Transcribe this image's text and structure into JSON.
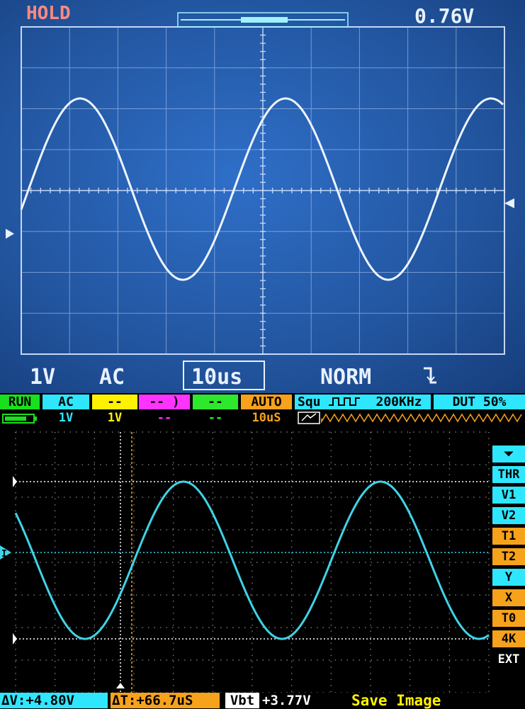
{
  "top_screen": {
    "hold_label": "HOLD",
    "voltage_readout": "0.76V",
    "channel_volts": "1V",
    "coupling": "AC",
    "timebase": "10us",
    "trigger_mode": "NORM",
    "trigger_edge_icon": "falling-edge-icon",
    "colors": {
      "screen": "#2a63b6",
      "trace": "#e8f1ff",
      "hold": "#ff8a80"
    }
  },
  "status_bar": {
    "run_label": "RUN",
    "coupling_label": "AC",
    "ch2_label": "--",
    "ch3_label": "-- )",
    "ch4_label": "--",
    "auto_label": "AUTO",
    "signal_type": "Squ",
    "frequency": "200KHz",
    "duty": "DUT 50%",
    "ch1_volts": "1V",
    "ch2_volts": "1V",
    "ch3_volts": "--",
    "ch4_volts": "--",
    "timebase": "10uS"
  },
  "side_menu": {
    "items": [
      {
        "label": "⏷",
        "name": "trigger-edge",
        "color": "cyan"
      },
      {
        "label": "THR",
        "name": "thr",
        "color": "cyan"
      },
      {
        "label": "V1",
        "name": "v1",
        "color": "cyan"
      },
      {
        "label": "V2",
        "name": "v2",
        "color": "cyan"
      },
      {
        "label": "T1",
        "name": "t1",
        "color": "orange"
      },
      {
        "label": "T2",
        "name": "t2",
        "color": "orange"
      },
      {
        "label": "Y",
        "name": "y",
        "color": "cyan"
      },
      {
        "label": "X",
        "name": "x",
        "color": "orange"
      },
      {
        "label": "T0",
        "name": "t0",
        "color": "orange"
      },
      {
        "label": "4K",
        "name": "4k",
        "color": "orange"
      },
      {
        "label": "EXT",
        "name": "ext",
        "color": "white"
      }
    ]
  },
  "bottom_status": {
    "delta_v": "ΔV:+4.80V",
    "delta_t": "ΔT:+66.7uS",
    "vbt_label": "Vbt",
    "vbt_value": "+3.77V",
    "save_label": "Save Image"
  },
  "trace_colors": {
    "cyan": "#3fd3e8",
    "orange": "#f5a020",
    "white": "#ffffff"
  }
}
